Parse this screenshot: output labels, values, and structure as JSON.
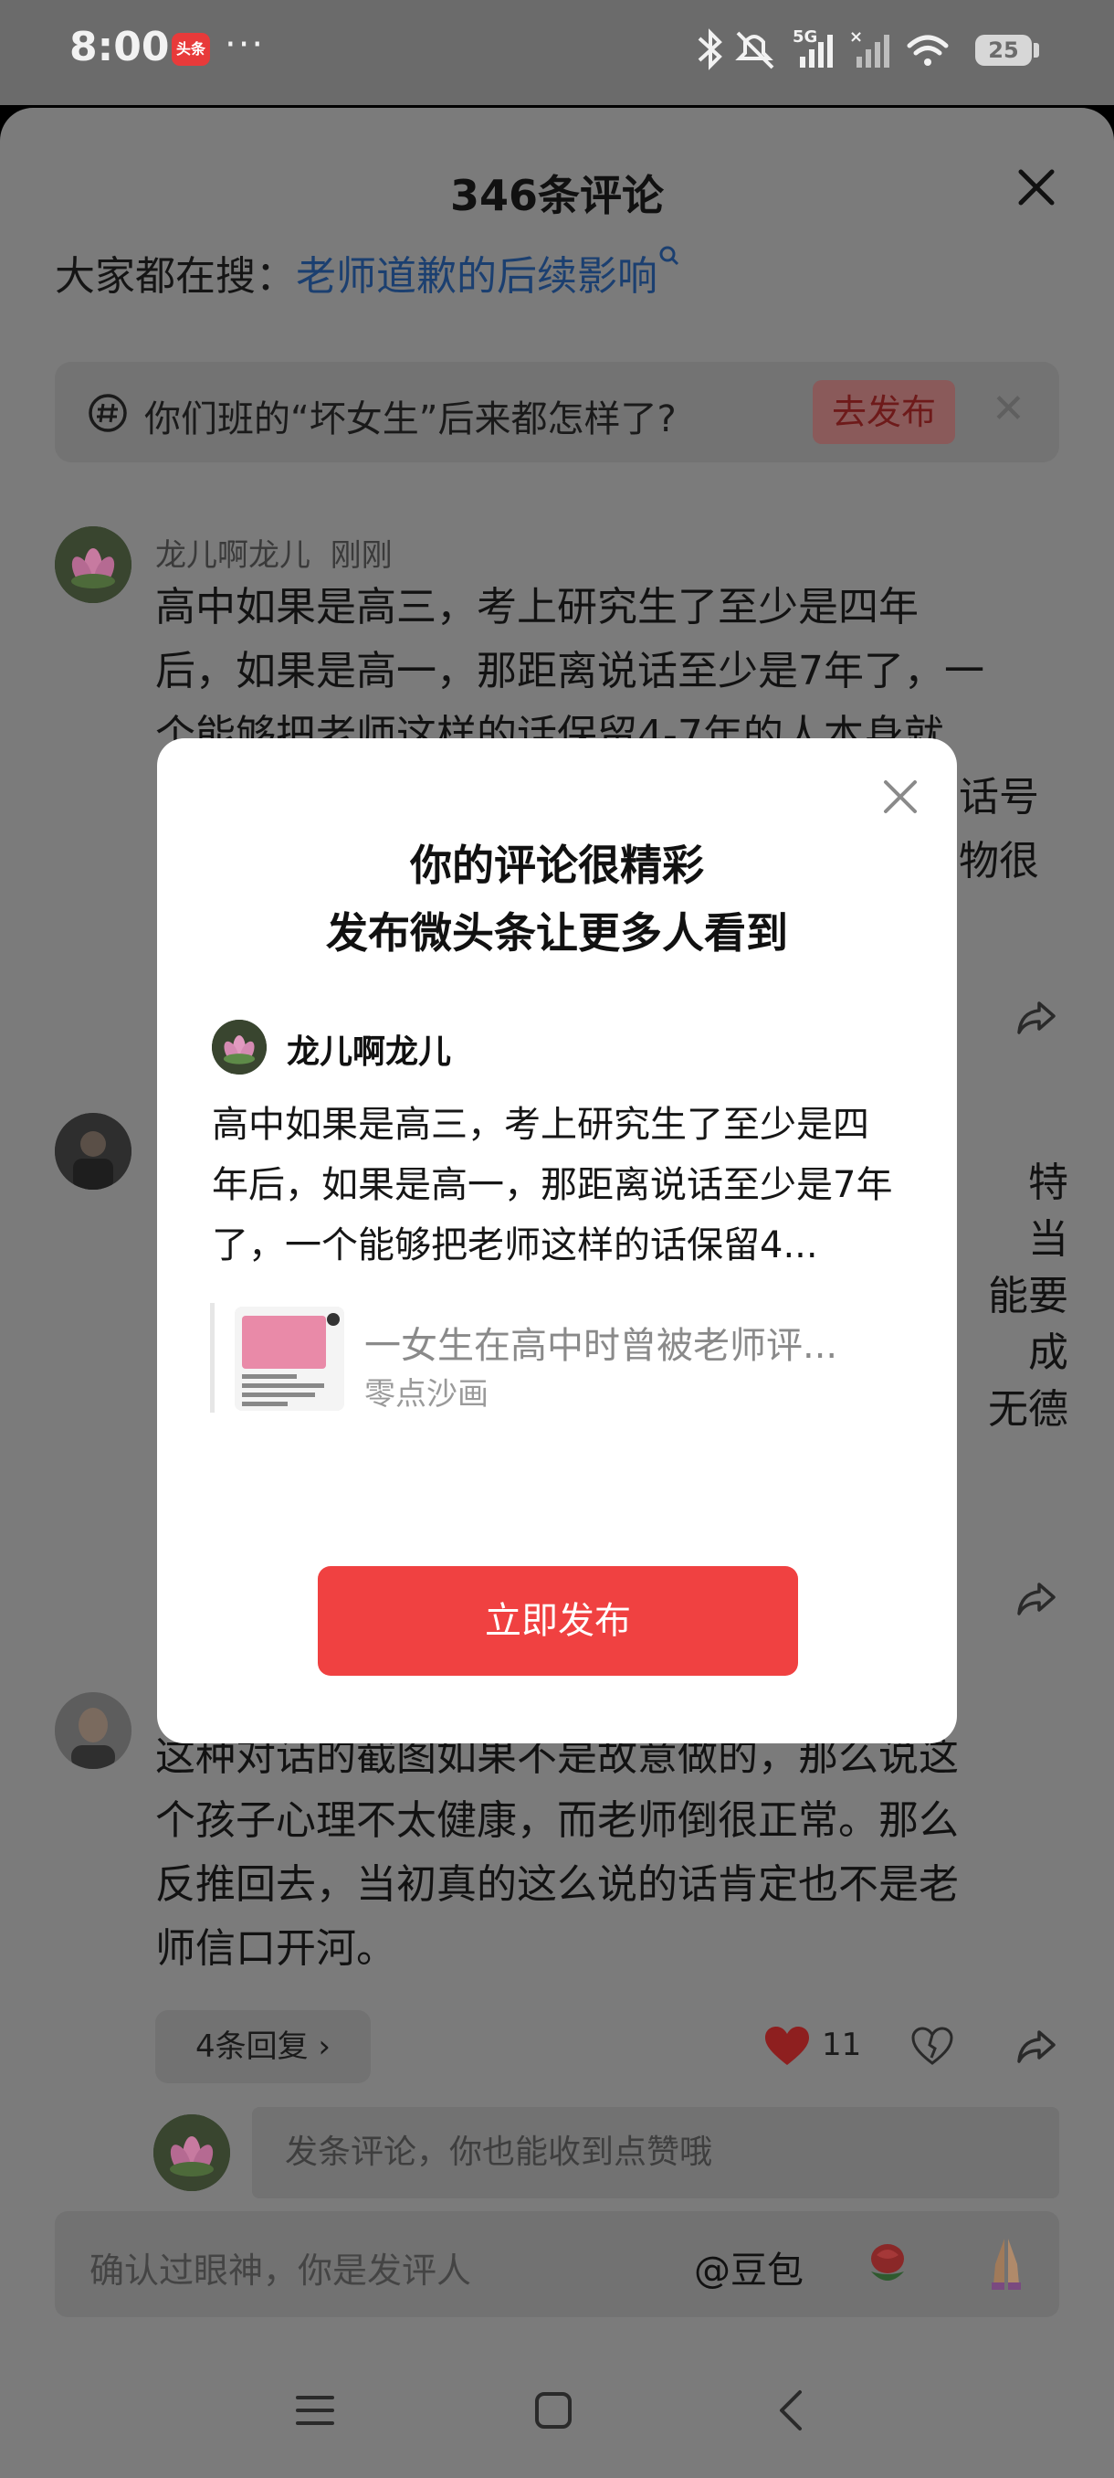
{
  "status_bar": {
    "time": "8:00",
    "app_badge": "头条",
    "more": "···",
    "battery": "25"
  },
  "sheet": {
    "title": "346条评论",
    "search_prefix": "大家都在搜：",
    "search_link": "老师道歉的后续影响",
    "topic": {
      "text": "你们班的“坏女生”后来都怎样了?",
      "action": "去发布"
    }
  },
  "comments": [
    {
      "name": "龙儿啊龙儿",
      "time": "刚刚",
      "lines": [
        "高中如果是高三，考上研究生了至少是四年",
        "后，如果是高一，那距离说话至少是7年了，一",
        "个能够把老师这样的话保留4-7年的人本身就"
      ],
      "right_fragments": [
        "话号",
        "物很"
      ]
    },
    {
      "right_fragments": [
        "特",
        "当",
        "能要",
        "成",
        "无德"
      ]
    },
    {
      "lines": [
        "这种对话的截图如果不是故意做的，那么说这",
        "个孩子心理不太健康，而老师倒很正常。那么",
        "反推回去，当初真的这么说的话肯定也不是老",
        "师信口开河。"
      ],
      "replies": "4条回复 ›",
      "likes": "11"
    }
  ],
  "my_comment_placeholder": "发条评论，你也能收到点赞哦",
  "bottom_input": {
    "placeholder": "确认过眼神，你是发评人",
    "doubao": "@豆包"
  },
  "dialog": {
    "title_line1": "你的评论很精彩",
    "title_line2": "发布微头条让更多人看到",
    "user": "龙儿啊龙儿",
    "text": "高中如果是高三，考上研究生了至少是四年后，如果是高一，那距离说话至少是7年了，一个能够把老师这样的话保留4...",
    "quote_title": "一女生在高中时曾被老师评...",
    "quote_source": "零点沙画",
    "publish": "立即发布"
  },
  "colors": {
    "accent": "#f04141",
    "dim_bg": "#7b7b7b",
    "link": "#1b3f70"
  },
  "icons": [
    "bluetooth-icon",
    "mute-icon",
    "signal-icon",
    "wifi-icon",
    "battery-icon",
    "close-icon",
    "hashtag-icon",
    "share-icon",
    "heart-icon",
    "emoji-rose-icon",
    "emoji-pray-icon",
    "menu-icon",
    "home-icon",
    "back-icon"
  ]
}
